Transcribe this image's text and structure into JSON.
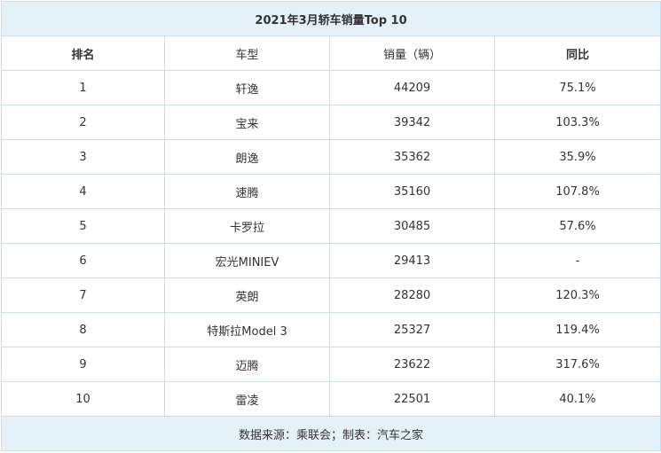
{
  "table": {
    "title": "2021年3月轿车销量Top 10",
    "headers": [
      "排名",
      "车型",
      "销量（辆）",
      "同比"
    ],
    "rows": [
      [
        "1",
        "轩逸",
        "44209",
        "75.1%"
      ],
      [
        "2",
        "宝来",
        "39342",
        "103.3%"
      ],
      [
        "3",
        "朗逸",
        "35362",
        "35.9%"
      ],
      [
        "4",
        "速腾",
        "35160",
        "107.8%"
      ],
      [
        "5",
        "卡罗拉",
        "30485",
        "57.6%"
      ],
      [
        "6",
        "宏光MINIEV",
        "29413",
        "-"
      ],
      [
        "7",
        "英朗",
        "28280",
        "120.3%"
      ],
      [
        "8",
        "特斯拉Model 3",
        "25327",
        "119.4%"
      ],
      [
        "9",
        "迈腾",
        "23622",
        "317.6%"
      ],
      [
        "10",
        "雷凌",
        "22501",
        "40.1%"
      ]
    ],
    "footer": "数据来源：乘联会；制表：汽车之家"
  },
  "colors": {
    "title_background": "#e5f1f9",
    "border": "#c7dfee",
    "text": "#333333"
  }
}
